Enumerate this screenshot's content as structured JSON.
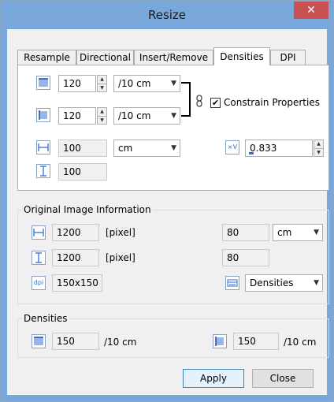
{
  "window": {
    "title": "Resize",
    "close_glyph": "✕"
  },
  "tabs": [
    {
      "label": "Resample"
    },
    {
      "label": "Directional"
    },
    {
      "label": "Insert/Remove"
    },
    {
      "label": "Densities",
      "active": true
    },
    {
      "label": "DPI"
    }
  ],
  "densities_tab": {
    "horizontal_density": "120",
    "horizontal_unit": "/10 cm",
    "vertical_density": "120",
    "vertical_unit": "/10 cm",
    "constrain_label": "Constrain Properties",
    "constrain_checked": true,
    "width_value": "100",
    "width_unit": "cm",
    "height_value": "100",
    "ratio_value": "0.833"
  },
  "original_info": {
    "title": "Original Image Information",
    "width_px": "1200",
    "width_px_unit": "[pixel]",
    "height_px": "1200",
    "height_px_unit": "[pixel]",
    "dpi": "150x150",
    "width_len": "80",
    "len_unit": "cm",
    "height_len": "80",
    "mode": "Densities"
  },
  "densities_group": {
    "title": "Densities",
    "horizontal": "150",
    "horizontal_unit": "/10 cm",
    "vertical": "150",
    "vertical_unit": "/10 cm"
  },
  "buttons": {
    "apply": "Apply",
    "close": "Close"
  },
  "icons": {
    "hdensity": "horizontal-density-icon",
    "vdensity": "vertical-density-icon",
    "width": "width-icon",
    "height": "height-icon",
    "ratio": "ratio-icon",
    "chain": "chain-link-icon",
    "dpi": "dpi-icon",
    "mode": "mode-icon"
  },
  "icon_labels": {
    "ratio": "×V",
    "dpi": "dpi"
  },
  "colors": {
    "title_bar": "#7aa7d9",
    "close_button": "#c75050",
    "accent": "#2e6fd8"
  }
}
